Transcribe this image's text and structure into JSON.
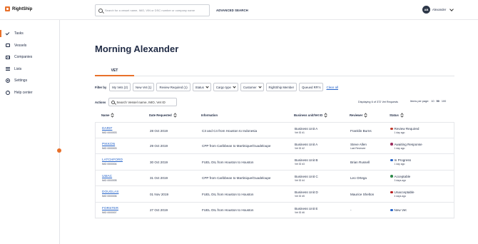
{
  "brand": {
    "name": "RightShip"
  },
  "topbar": {
    "search_placeholder": "Search for a vessel name, IMO, VIN or DSC number or company name",
    "advanced_search": "ADVANCED SEARCH",
    "user": {
      "initials": "AB",
      "name": "Alexander"
    }
  },
  "sidebar": {
    "items": [
      {
        "label": "Tasks",
        "icon": "check-icon",
        "active": true
      },
      {
        "label": "Vessels",
        "icon": "folder-icon"
      },
      {
        "label": "Companies",
        "icon": "building-icon"
      },
      {
        "label": "Lists",
        "icon": "list-icon"
      },
      {
        "label": "Settings",
        "icon": "gear-icon"
      },
      {
        "label": "Help center",
        "icon": "help-icon"
      }
    ]
  },
  "main": {
    "title": "Morning Alexander",
    "tabs": [
      {
        "label": "VET",
        "active": true
      }
    ],
    "filter_label": "Filter by",
    "filters": [
      {
        "label": "My Vets (2)",
        "dropdown": false
      },
      {
        "label": "New Vet (1)",
        "dropdown": false
      },
      {
        "label": "Review Required (1)",
        "dropdown": false
      },
      {
        "label": "Status",
        "dropdown": true
      },
      {
        "label": "Cargo type",
        "dropdown": true
      },
      {
        "label": "Customer",
        "dropdown": true
      },
      {
        "label": "RightShip Member",
        "dropdown": false
      },
      {
        "label": "Queued RFI's",
        "dropdown": false
      }
    ],
    "clear_all": "Clear all",
    "actions_label": "Actions",
    "table_search_placeholder": "Search Vessel name, IMO, Vet ID",
    "displaying": "Displaying 6 of 372 Vet Requests",
    "items_per_page": {
      "label": "Items per page:",
      "options": [
        "10",
        "50",
        "100"
      ],
      "selected": "50"
    }
  },
  "table": {
    "headers": {
      "name": "Name",
      "date": "Date Requested",
      "info": "Information",
      "bu": "Business unit/Vet ID",
      "reviewer": "Reviewer",
      "status": "Status"
    },
    "rows": [
      {
        "vessel": "DARIF",
        "imo": "IMO 0000003",
        "date": "28 Oct 2019",
        "info": "C3 and C4 from Houston to Indonesia",
        "bu": "Business Unit A",
        "vet_id": "Vet ID #1",
        "reviewer": "Franklin Burns",
        "reviewer_sub": "",
        "status": "Review Required",
        "status_color": "#c0392b",
        "status_time": "1 day ago"
      },
      {
        "vessel": "PIKKON",
        "imo": "IMO 0000003",
        "date": "29 Oct 2019",
        "info": "CPP from Caribbean to Martinique/Guadeloupe",
        "bu": "Business Unit A",
        "vet_id": "Vet ID #2",
        "reviewer": "Steve Allen",
        "reviewer_sub": "Last Reviewer",
        "status": "Awaiting Response",
        "status_color": "#9b2c5e",
        "status_time": "1 day ago"
      },
      {
        "vessel": "LATCHFORD",
        "imo": "IMO 0000004",
        "date": "30 Oct 2019",
        "info": "FUEL OIL from Houston to Houston",
        "bu": "Business Unit B",
        "vet_id": "Vet ID #3",
        "reviewer": "Brian Russell",
        "reviewer_sub": "",
        "status": "In Progress",
        "status_color": "#2563c9",
        "status_time": "1 day ago"
      },
      {
        "vessel": "UMAC",
        "imo": "IMO 0000005",
        "date": "31 Oct 2019",
        "info": "CPP from Caribbean to Martinique/Guadeloupe",
        "bu": "Business Unit C",
        "vet_id": "Vet ID #4",
        "reviewer": "Leo Ortega",
        "reviewer_sub": "",
        "status": "Acceptable",
        "status_color": "#2f8a4a",
        "status_time": "3 days ago"
      },
      {
        "vessel": "DOUGLAS",
        "imo": "IMO 0000006",
        "date": "01 Nov 2019",
        "info": "FUEL OIL from Houston to Houston",
        "bu": "Business Unit D",
        "vet_id": "Vet ID #5",
        "reviewer": "Maurice Shelton",
        "reviewer_sub": "",
        "status": "Unacceptable",
        "status_color": "#b91c1c",
        "status_time": "4 days ago"
      },
      {
        "vessel": "FORSTER",
        "imo": "IMO 0000007",
        "date": "27 Oct 2019",
        "info": "FUEL OIL from Houston to Houston",
        "bu": "Business Unit E",
        "vet_id": "Vet ID #6",
        "reviewer": "-",
        "reviewer_sub": "",
        "status": "New Vet",
        "status_color": "#2563c9",
        "status_time": ""
      }
    ]
  }
}
